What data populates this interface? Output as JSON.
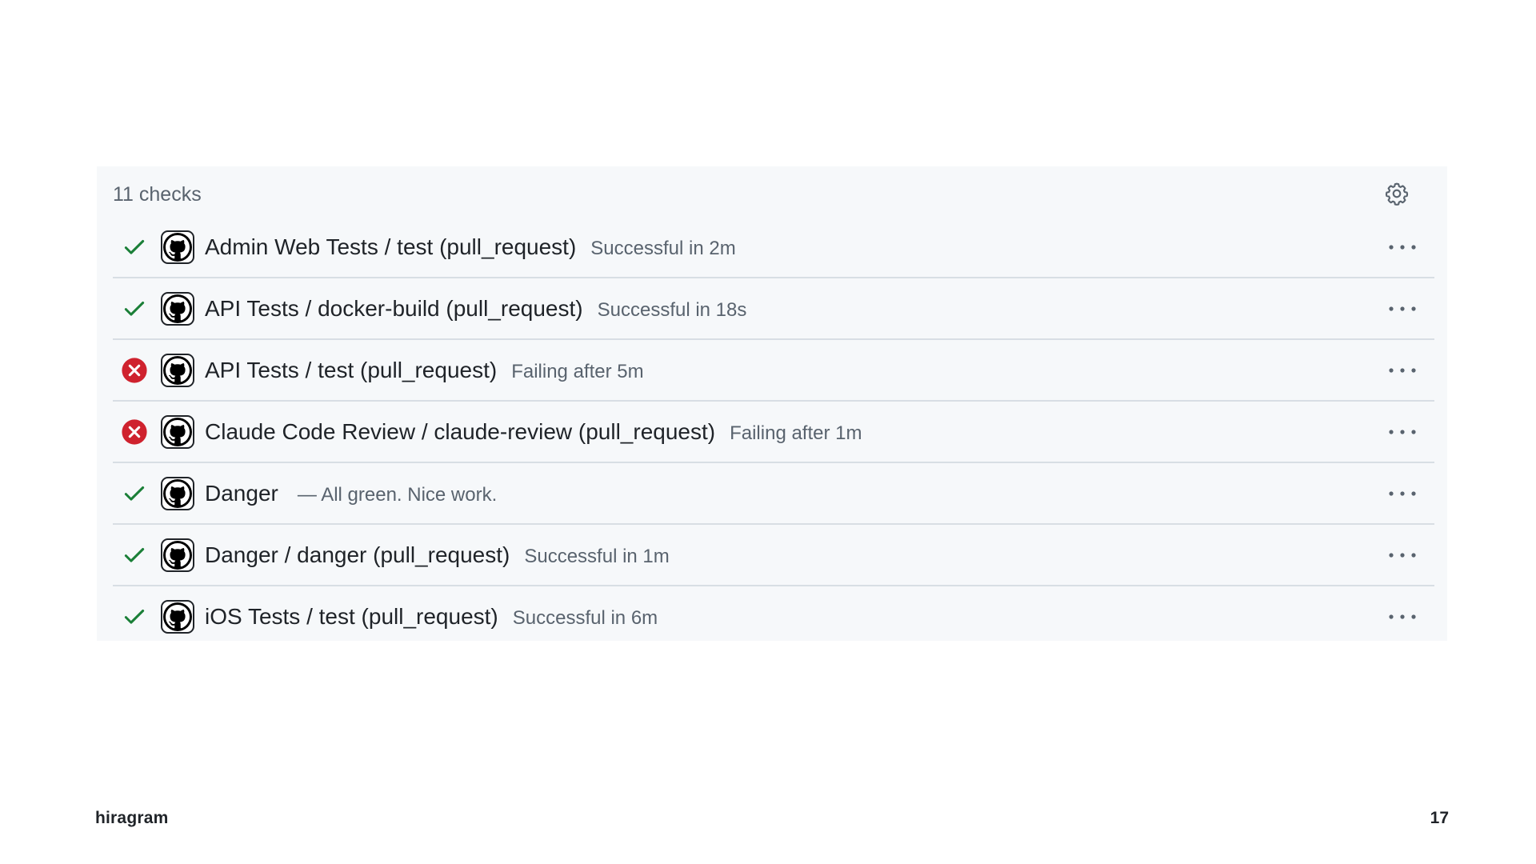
{
  "panel": {
    "checks_count": "11 checks",
    "settings_icon": "gear-icon",
    "more_icon": "kebab-horizontal-icon",
    "app_icon": "github-icon"
  },
  "colors": {
    "success": "#1a7f37",
    "failure": "#cf222e",
    "panel_bg": "#f6f8fa",
    "muted_text": "#59636e"
  },
  "checks": [
    {
      "status": "success",
      "name": "Admin Web Tests / test (pull_request)",
      "description": "Successful in 2m"
    },
    {
      "status": "success",
      "name": "API Tests / docker-build (pull_request)",
      "description": "Successful in 18s"
    },
    {
      "status": "failure",
      "name": "API Tests / test (pull_request)",
      "description": "Failing after 5m"
    },
    {
      "status": "failure",
      "name": "Claude Code Review / claude-review (pull_request)",
      "description": "Failing after 1m"
    },
    {
      "status": "success",
      "name": "Danger",
      "description": "— All green. Nice work."
    },
    {
      "status": "success",
      "name": "Danger / danger (pull_request)",
      "description": "Successful in 1m"
    },
    {
      "status": "success",
      "name": "iOS Tests / test (pull_request)",
      "description": "Successful in 6m"
    }
  ],
  "footer": {
    "brand": "hiragram",
    "page_number": "17"
  }
}
